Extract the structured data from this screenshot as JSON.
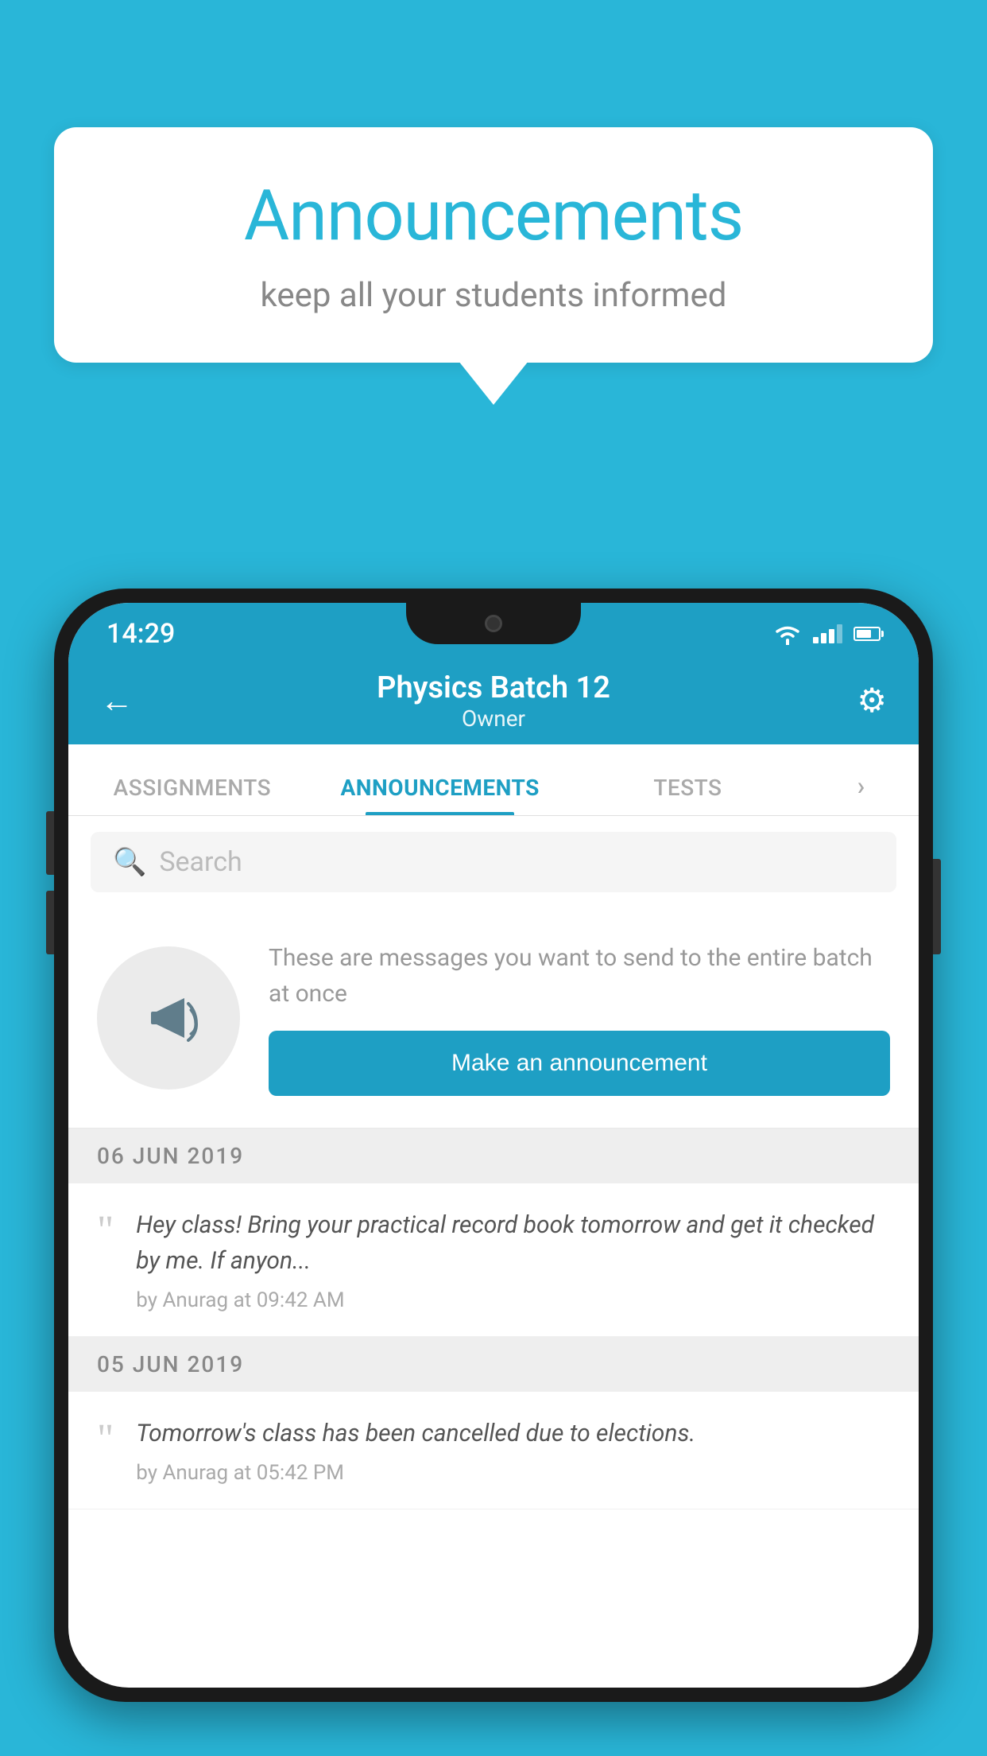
{
  "background_color": "#29b6d8",
  "speech_bubble": {
    "title": "Announcements",
    "subtitle": "keep all your students informed"
  },
  "phone": {
    "status_bar": {
      "time": "14:29"
    },
    "header": {
      "batch_name": "Physics Batch 12",
      "role": "Owner",
      "back_label": "←",
      "gear_label": "⚙"
    },
    "tabs": [
      {
        "label": "ASSIGNMENTS",
        "active": false
      },
      {
        "label": "ANNOUNCEMENTS",
        "active": true
      },
      {
        "label": "TESTS",
        "active": false
      },
      {
        "label": "›",
        "active": false
      }
    ],
    "search": {
      "placeholder": "Search"
    },
    "announcement_prompt": {
      "description_text": "These are messages you want to send to the entire batch at once",
      "button_label": "Make an announcement"
    },
    "announcements": [
      {
        "date": "06  JUN  2019",
        "text": "Hey class! Bring your practical record book tomorrow and get it checked by me. If anyon...",
        "author": "by Anurag at 09:42 AM"
      },
      {
        "date": "05  JUN  2019",
        "text": "Tomorrow's class has been cancelled due to elections.",
        "author": "by Anurag at 05:42 PM"
      }
    ]
  }
}
